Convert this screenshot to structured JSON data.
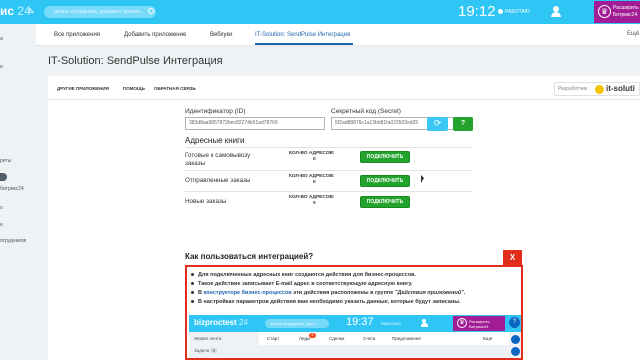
{
  "header": {
    "logo_text": "ис",
    "logo_num": "24",
    "search_placeholder": "искать сотрудника, документ, прочее...",
    "clock": "19:12",
    "work_status": "РАБОТАЮ",
    "upgrade_line1": "Расширить",
    "upgrade_line2": "Битрикс24"
  },
  "sidebar": {
    "items": [
      "а",
      "и",
      "реты",
      "битрикс24",
      "о",
      "е",
      "отрудников"
    ]
  },
  "tabs": {
    "items": [
      "Все приложения",
      "Добавить приложение",
      "Вебхуки",
      "IT-Solution: SendPulse Интеграция"
    ],
    "more": "Ещё"
  },
  "page": {
    "title": "IT-Solution: SendPulse Интеграция"
  },
  "app_menu": {
    "links": [
      "ДРУГИЕ ПРИЛОЖЕНИЯ",
      "ПОМОЩЬ",
      "ОБРАТНАЯ СВЯЗЬ"
    ],
    "developer_label": "Разработчик",
    "developer_name": "it-soluti"
  },
  "credentials": {
    "id_label": "Идентификатор (ID)",
    "id_value": "383d8aa9857872bec82274b51ad78769",
    "secret_label": "Секретный код (Secret)",
    "secret_value": "5f2ad88876c1a13bb81fa023502ed25",
    "help_label": "?"
  },
  "address_books": {
    "title": "Адресные книги",
    "count_label": "КОЛ-ВО АДРЕСОВ:",
    "connect_label": "ПОДКЛЮЧИТЬ",
    "rows": [
      {
        "name_line1": "Готовые к самовывозу",
        "name_line2": "заказы",
        "count": "0"
      },
      {
        "name_line1": "Отправленные заказы",
        "name_line2": "",
        "count": "0"
      },
      {
        "name_line1": "Новые заказы",
        "name_line2": "",
        "count": "0"
      }
    ]
  },
  "howto": {
    "title": "Как пользоваться интеграцией?",
    "close": "X",
    "bullet1": "Для подключенных адресных книг создаются действия для бизнес-процессов.",
    "bullet2": "Такое действие записывает E-mail адрес в соответствующую адресную книгу.",
    "bullet3_pre": "В ",
    "bullet3_link": "конструкторе бизнес-процессов",
    "bullet3_mid": " эти действия расположены в группе ",
    "bullet3_em": "\"Действия приложений\"",
    "bullet3_post": ".",
    "bullet4": "В настройках параметров действия вам необходимо указать данные, которые будут записаны."
  },
  "embedded": {
    "logo_text": "bizproctest",
    "logo_num": "24",
    "search_placeholder": "искать сотрудника, доку...",
    "clock": "19:37",
    "work_status": "РАБОТАЮ",
    "upgrade_line1": "Расширить",
    "upgrade_line2": "Битрикс24",
    "help": "?",
    "side_items": [
      "Живая лента",
      "Задачи"
    ],
    "side_badge": "4",
    "nav_items": [
      "Старт",
      "Лиды",
      "Сделки",
      "Счета",
      "Предложения",
      "Ещё"
    ],
    "nav_badge": "5"
  }
}
